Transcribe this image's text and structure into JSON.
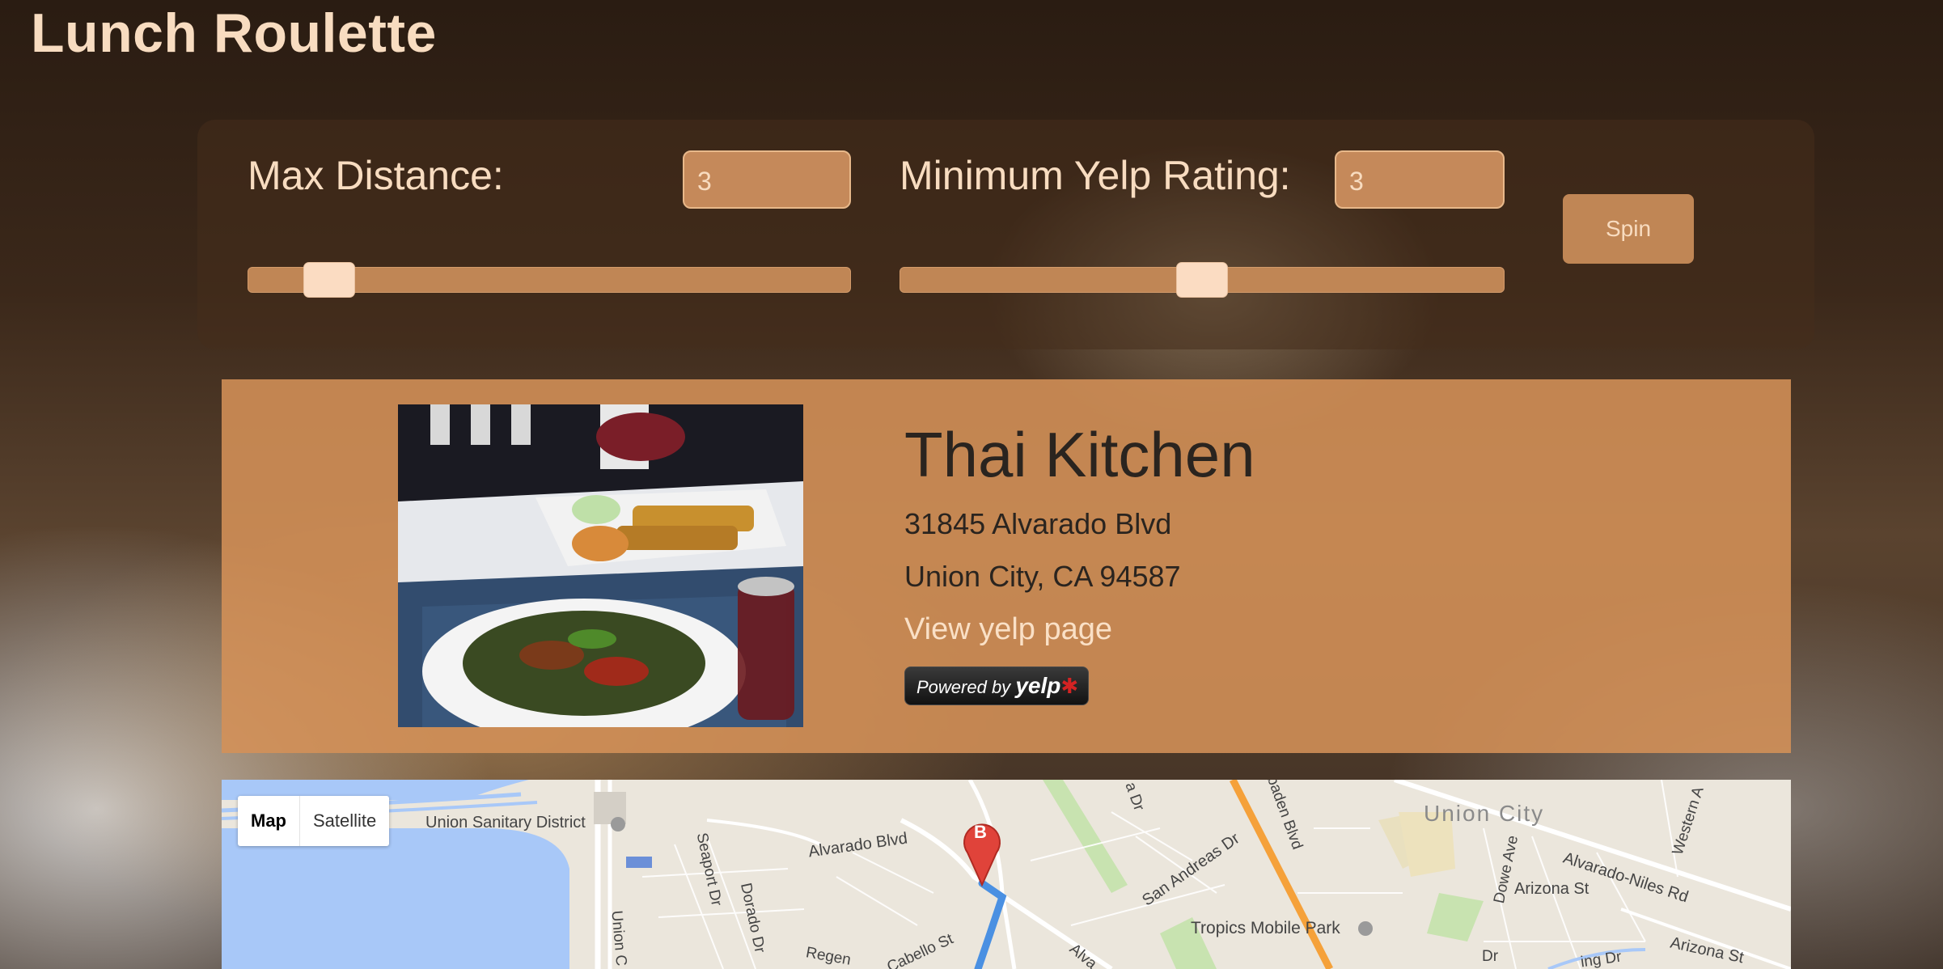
{
  "app": {
    "title": "Lunch Roulette"
  },
  "controls": {
    "max_distance": {
      "label": "Max Distance:",
      "value": "3",
      "slider_fraction": 0.1
    },
    "min_rating": {
      "label": "Minimum Yelp Rating:",
      "value": "3",
      "slider_fraction": 0.5
    },
    "spin_label": "Spin"
  },
  "result": {
    "name": "Thai Kitchen",
    "address_line1": "31845 Alvarado Blvd",
    "address_line2": "Union City, CA 94587",
    "yelp_link_label": "View yelp page",
    "badge": {
      "prefix": "Powered by",
      "brand": "yelp"
    },
    "photo_icon": "food-photo"
  },
  "map": {
    "types": [
      "Map",
      "Satellite"
    ],
    "active_type": "Map",
    "marker_label": "B",
    "labels": {
      "union_sanitary": "Union Sanitary District",
      "union_city": "Union City",
      "alvarado_blvd": "Alvarado Blvd",
      "alvarado_niles": "Alvarado-Niles Rd",
      "arizona_st": "Arizona St",
      "arizona_st_2": "Arizona St",
      "tropics": "Tropics Mobile Park",
      "san_andreas": "San Andreas Dr",
      "seaport": "Seaport Dr",
      "dorado": "Dorado Dr",
      "union_c": "Union C",
      "dowe": "Dowe Ave",
      "western": "Western A",
      "regen": "Regen",
      "cabello": "Cabello St",
      "alva": "Alva",
      "baden": "baden Blvd",
      "a_dr": "a Dr",
      "ing_dr": "ing Dr",
      "tree_dr": "Dr"
    },
    "colors": {
      "water": "#a8c8f8",
      "freeway": "#f5a13a",
      "route": "#4a90e2",
      "park": "#c8e3b0",
      "marker": "#e0433a"
    }
  }
}
